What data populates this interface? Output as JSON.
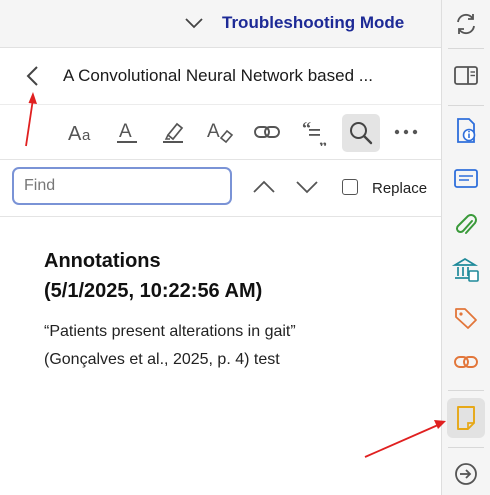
{
  "header": {
    "mode_label": "Troubleshooting Mode"
  },
  "document": {
    "title": "A Convolutional Neural Network based ..."
  },
  "toolbar": {
    "buttons": [
      "font-size-icon",
      "text-color-icon",
      "highlighter-icon",
      "eraser-text-icon",
      "link-icon",
      "quote-icon",
      "search-icon",
      "more-icon"
    ],
    "active": "search-icon"
  },
  "find": {
    "placeholder": "Find",
    "value": "",
    "replace_label": "Replace",
    "replace_checked": false
  },
  "notes": {
    "heading_line1": "Annotations",
    "heading_line2": "(5/1/2025, 10:22:56 AM)",
    "quote": "“Patients present alterations in gait”",
    "citation": "(Gonçalves et al., 2025, p. 4) test"
  },
  "sidebar": {
    "items": [
      "sync-icon",
      "reader-pane-icon",
      "info-icon",
      "abstract-icon",
      "attachments-icon",
      "libraries-collections-icon",
      "tags-icon",
      "related-icon",
      "notes-icon",
      "locate-icon"
    ],
    "active": "notes-icon"
  },
  "colors": {
    "mode_label": "#1d2a96",
    "annotation_arrow": "#e02020",
    "icon_blue": "#2f6fdb",
    "icon_green": "#3a9a3a",
    "icon_teal": "#1f8a9a",
    "icon_orange": "#e2763a",
    "icon_yellow": "#e7a817"
  }
}
